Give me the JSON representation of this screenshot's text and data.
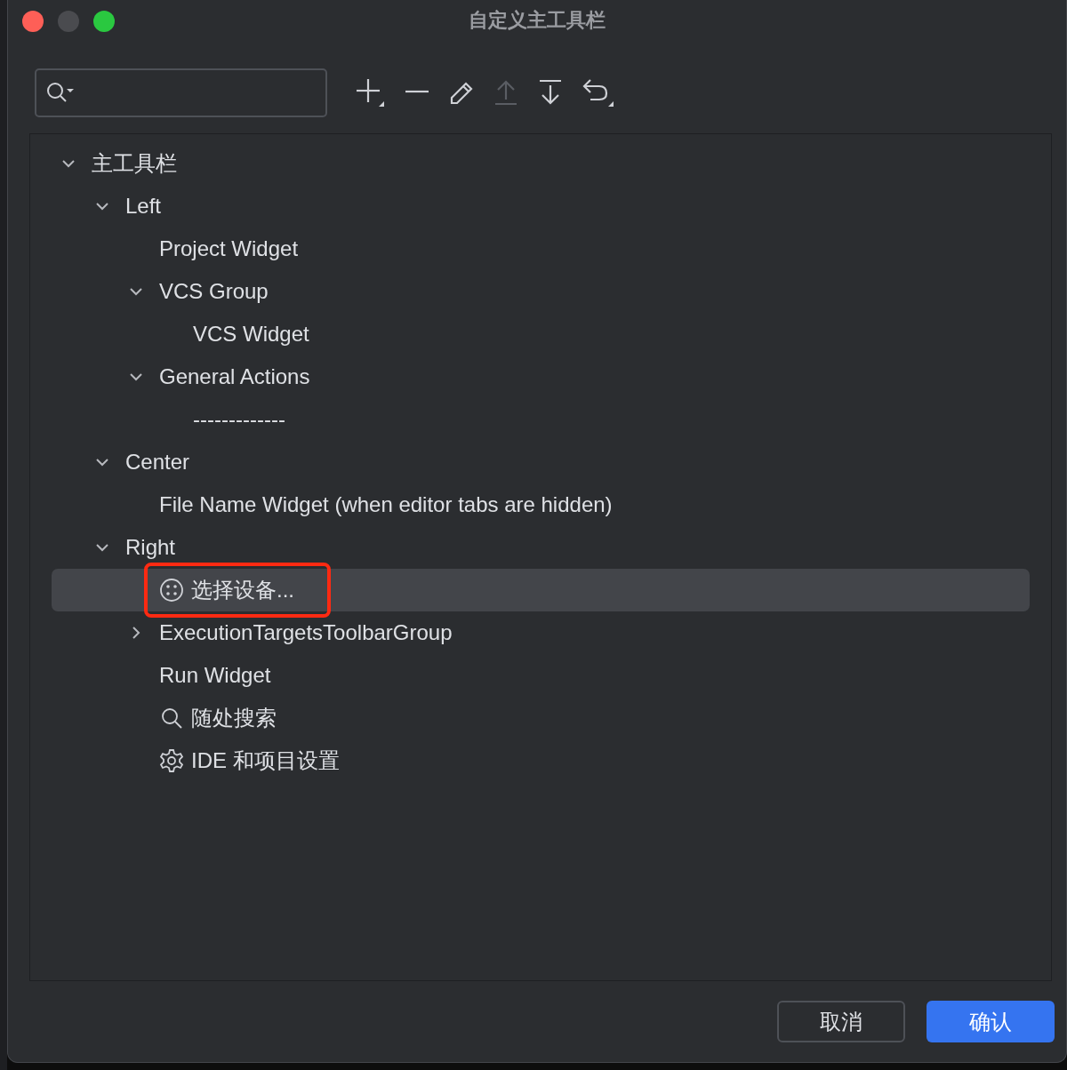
{
  "window": {
    "title": "自定义主工具栏"
  },
  "toolbar": [
    {
      "kind": "add",
      "disabled": false
    },
    {
      "kind": "remove",
      "disabled": false
    },
    {
      "kind": "edit",
      "disabled": false
    },
    {
      "kind": "move-up",
      "disabled": true
    },
    {
      "kind": "move-down",
      "disabled": false
    },
    {
      "kind": "restore",
      "disabled": false
    }
  ],
  "tree": [
    {
      "label": "主工具栏",
      "expanded": true,
      "children": [
        {
          "label": "Left",
          "expanded": true,
          "children": [
            {
              "label": "Project Widget"
            },
            {
              "label": "VCS Group",
              "expanded": true,
              "children": [
                {
                  "label": "VCS Widget"
                }
              ]
            },
            {
              "label": "General Actions",
              "expanded": true,
              "children": [
                {
                  "label": "-------------"
                }
              ]
            }
          ]
        },
        {
          "label": "Center",
          "expanded": true,
          "children": [
            {
              "label": "File Name Widget (when editor tabs are hidden)"
            }
          ]
        },
        {
          "label": "Right",
          "expanded": true,
          "children": [
            {
              "label": "选择设备...",
              "kind": "devices",
              "selected": true,
              "highlighted": true
            },
            {
              "label": "ExecutionTargetsToolbarGroup",
              "expanded": false,
              "selected": false
            },
            {
              "label": "Run Widget",
              "selected": false
            },
            {
              "label": "随处搜索",
              "kind": "search",
              "selected": false
            },
            {
              "label": "IDE 和项目设置",
              "kind": "gear",
              "selected": false
            }
          ]
        }
      ]
    }
  ],
  "buttons": [
    {
      "label": "取消",
      "kind": "secondary"
    },
    {
      "label": "确认",
      "kind": "primary"
    }
  ]
}
